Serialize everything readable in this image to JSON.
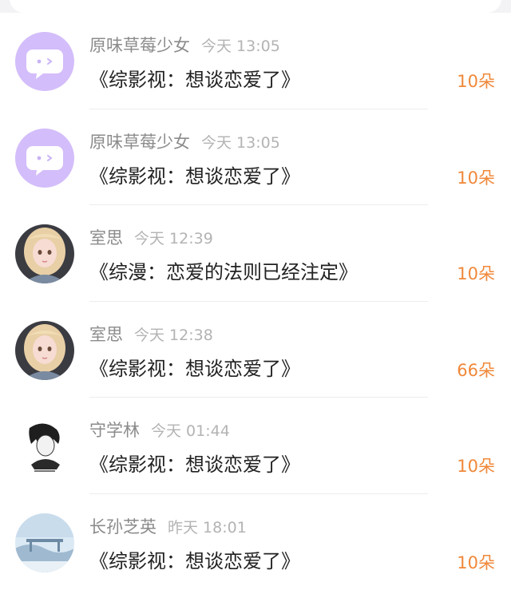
{
  "messages": [
    {
      "user": "原味草莓少女",
      "time": "今天 13:05",
      "title": "《综影视：想谈恋爱了》",
      "gift": "10朵",
      "avatar_icon": "default-chat-bubble-avatar"
    },
    {
      "user": "原味草莓少女",
      "time": "今天 13:05",
      "title": "《综影视：想谈恋爱了》",
      "gift": "10朵",
      "avatar_icon": "default-chat-bubble-avatar"
    },
    {
      "user": "室思",
      "time": "今天 12:39",
      "title": "《综漫：恋爱的法则已经注定》",
      "gift": "10朵",
      "avatar_icon": "anime-girl-avatar"
    },
    {
      "user": "室思",
      "time": "今天 12:38",
      "title": "《综影视：想谈恋爱了》",
      "gift": "66朵",
      "avatar_icon": "anime-girl-avatar"
    },
    {
      "user": "守学林",
      "time": "今天 01:44",
      "title": "《综影视：想谈恋爱了》",
      "gift": "10朵",
      "avatar_icon": "sketch-boy-avatar"
    },
    {
      "user": "长孙芝英",
      "time": "昨天 18:01",
      "title": "《综影视：想谈恋爱了》",
      "gift": "10朵",
      "avatar_icon": "landscape-avatar"
    }
  ],
  "colors": {
    "gift": "#f0883a",
    "name": "#8b8b8b",
    "time": "#b3b3b3",
    "title": "#222222",
    "default_avatar_bg": "#d3bdfa"
  }
}
